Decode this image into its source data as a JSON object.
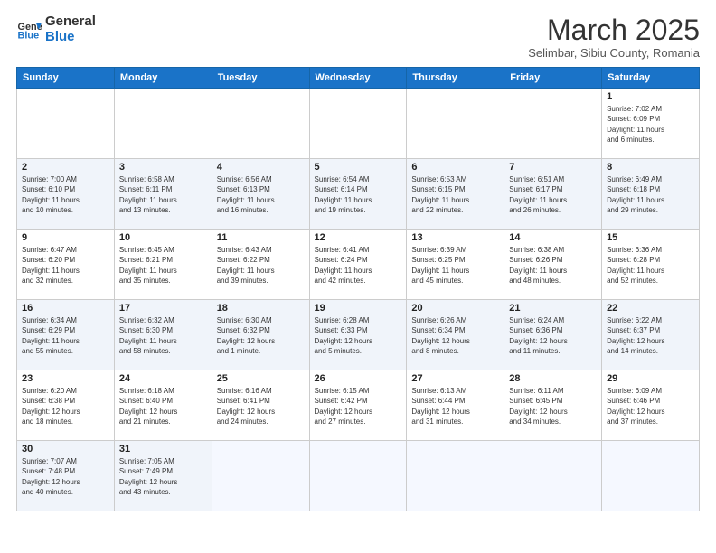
{
  "header": {
    "logo_general": "General",
    "logo_blue": "Blue",
    "title": "March 2025",
    "subtitle": "Selimbar, Sibiu County, Romania"
  },
  "weekdays": [
    "Sunday",
    "Monday",
    "Tuesday",
    "Wednesday",
    "Thursday",
    "Friday",
    "Saturday"
  ],
  "weeks": [
    [
      {
        "day": "",
        "info": ""
      },
      {
        "day": "",
        "info": ""
      },
      {
        "day": "",
        "info": ""
      },
      {
        "day": "",
        "info": ""
      },
      {
        "day": "",
        "info": ""
      },
      {
        "day": "",
        "info": ""
      },
      {
        "day": "1",
        "info": "Sunrise: 7:02 AM\nSunset: 6:09 PM\nDaylight: 11 hours\nand 6 minutes."
      }
    ],
    [
      {
        "day": "2",
        "info": "Sunrise: 7:00 AM\nSunset: 6:10 PM\nDaylight: 11 hours\nand 10 minutes."
      },
      {
        "day": "3",
        "info": "Sunrise: 6:58 AM\nSunset: 6:11 PM\nDaylight: 11 hours\nand 13 minutes."
      },
      {
        "day": "4",
        "info": "Sunrise: 6:56 AM\nSunset: 6:13 PM\nDaylight: 11 hours\nand 16 minutes."
      },
      {
        "day": "5",
        "info": "Sunrise: 6:54 AM\nSunset: 6:14 PM\nDaylight: 11 hours\nand 19 minutes."
      },
      {
        "day": "6",
        "info": "Sunrise: 6:53 AM\nSunset: 6:15 PM\nDaylight: 11 hours\nand 22 minutes."
      },
      {
        "day": "7",
        "info": "Sunrise: 6:51 AM\nSunset: 6:17 PM\nDaylight: 11 hours\nand 26 minutes."
      },
      {
        "day": "8",
        "info": "Sunrise: 6:49 AM\nSunset: 6:18 PM\nDaylight: 11 hours\nand 29 minutes."
      }
    ],
    [
      {
        "day": "9",
        "info": "Sunrise: 6:47 AM\nSunset: 6:20 PM\nDaylight: 11 hours\nand 32 minutes."
      },
      {
        "day": "10",
        "info": "Sunrise: 6:45 AM\nSunset: 6:21 PM\nDaylight: 11 hours\nand 35 minutes."
      },
      {
        "day": "11",
        "info": "Sunrise: 6:43 AM\nSunset: 6:22 PM\nDaylight: 11 hours\nand 39 minutes."
      },
      {
        "day": "12",
        "info": "Sunrise: 6:41 AM\nSunset: 6:24 PM\nDaylight: 11 hours\nand 42 minutes."
      },
      {
        "day": "13",
        "info": "Sunrise: 6:39 AM\nSunset: 6:25 PM\nDaylight: 11 hours\nand 45 minutes."
      },
      {
        "day": "14",
        "info": "Sunrise: 6:38 AM\nSunset: 6:26 PM\nDaylight: 11 hours\nand 48 minutes."
      },
      {
        "day": "15",
        "info": "Sunrise: 6:36 AM\nSunset: 6:28 PM\nDaylight: 11 hours\nand 52 minutes."
      }
    ],
    [
      {
        "day": "16",
        "info": "Sunrise: 6:34 AM\nSunset: 6:29 PM\nDaylight: 11 hours\nand 55 minutes."
      },
      {
        "day": "17",
        "info": "Sunrise: 6:32 AM\nSunset: 6:30 PM\nDaylight: 11 hours\nand 58 minutes."
      },
      {
        "day": "18",
        "info": "Sunrise: 6:30 AM\nSunset: 6:32 PM\nDaylight: 12 hours\nand 1 minute."
      },
      {
        "day": "19",
        "info": "Sunrise: 6:28 AM\nSunset: 6:33 PM\nDaylight: 12 hours\nand 5 minutes."
      },
      {
        "day": "20",
        "info": "Sunrise: 6:26 AM\nSunset: 6:34 PM\nDaylight: 12 hours\nand 8 minutes."
      },
      {
        "day": "21",
        "info": "Sunrise: 6:24 AM\nSunset: 6:36 PM\nDaylight: 12 hours\nand 11 minutes."
      },
      {
        "day": "22",
        "info": "Sunrise: 6:22 AM\nSunset: 6:37 PM\nDaylight: 12 hours\nand 14 minutes."
      }
    ],
    [
      {
        "day": "23",
        "info": "Sunrise: 6:20 AM\nSunset: 6:38 PM\nDaylight: 12 hours\nand 18 minutes."
      },
      {
        "day": "24",
        "info": "Sunrise: 6:18 AM\nSunset: 6:40 PM\nDaylight: 12 hours\nand 21 minutes."
      },
      {
        "day": "25",
        "info": "Sunrise: 6:16 AM\nSunset: 6:41 PM\nDaylight: 12 hours\nand 24 minutes."
      },
      {
        "day": "26",
        "info": "Sunrise: 6:15 AM\nSunset: 6:42 PM\nDaylight: 12 hours\nand 27 minutes."
      },
      {
        "day": "27",
        "info": "Sunrise: 6:13 AM\nSunset: 6:44 PM\nDaylight: 12 hours\nand 31 minutes."
      },
      {
        "day": "28",
        "info": "Sunrise: 6:11 AM\nSunset: 6:45 PM\nDaylight: 12 hours\nand 34 minutes."
      },
      {
        "day": "29",
        "info": "Sunrise: 6:09 AM\nSunset: 6:46 PM\nDaylight: 12 hours\nand 37 minutes."
      }
    ],
    [
      {
        "day": "30",
        "info": "Sunrise: 7:07 AM\nSunset: 7:48 PM\nDaylight: 12 hours\nand 40 minutes."
      },
      {
        "day": "31",
        "info": "Sunrise: 7:05 AM\nSunset: 7:49 PM\nDaylight: 12 hours\nand 43 minutes."
      },
      {
        "day": "",
        "info": ""
      },
      {
        "day": "",
        "info": ""
      },
      {
        "day": "",
        "info": ""
      },
      {
        "day": "",
        "info": ""
      },
      {
        "day": "",
        "info": ""
      }
    ]
  ]
}
